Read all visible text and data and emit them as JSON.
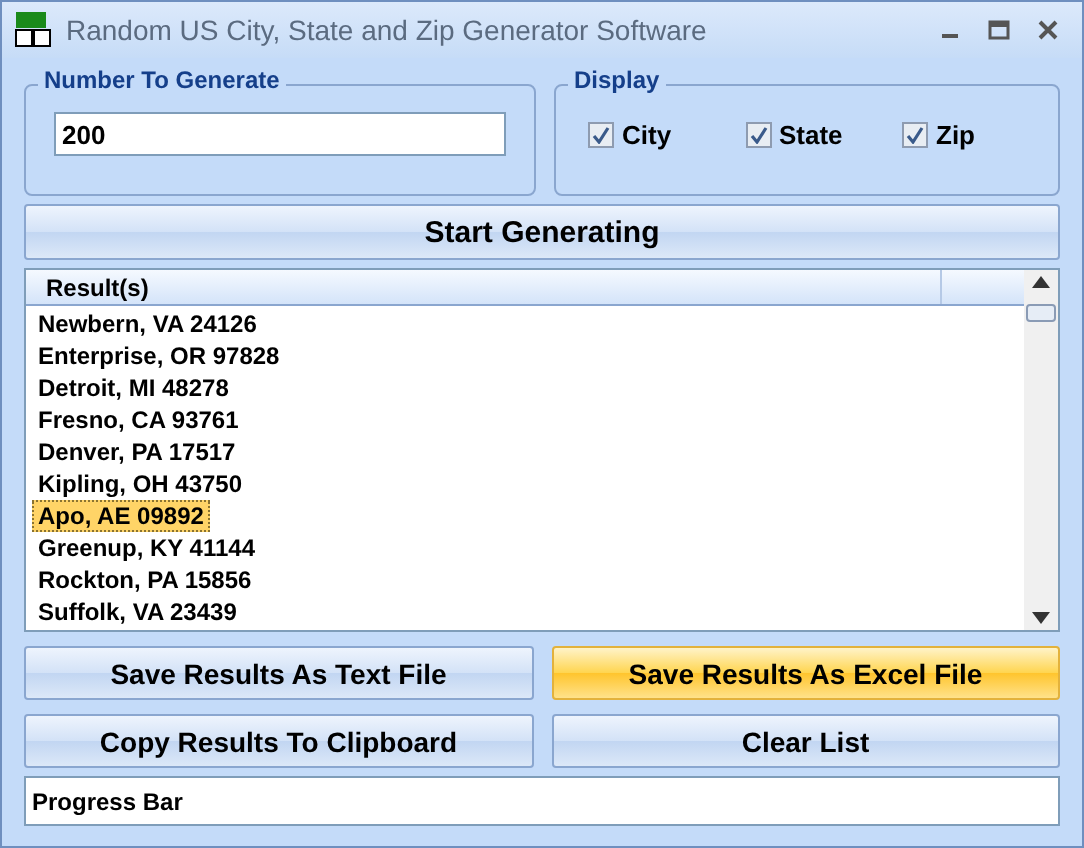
{
  "window": {
    "title": "Random US City, State and Zip Generator Software"
  },
  "number_group": {
    "label": "Number To Generate",
    "value": "200"
  },
  "display_group": {
    "label": "Display",
    "options": [
      {
        "label": "City",
        "checked": true
      },
      {
        "label": "State",
        "checked": true
      },
      {
        "label": "Zip",
        "checked": true
      }
    ]
  },
  "start_button": {
    "label": "Start Generating",
    "highlighted": false
  },
  "results": {
    "column": "Result(s)",
    "rows": [
      {
        "text": "Newbern, VA 24126",
        "selected": false
      },
      {
        "text": "Enterprise, OR 97828",
        "selected": false
      },
      {
        "text": "Detroit, MI 48278",
        "selected": false
      },
      {
        "text": "Fresno, CA 93761",
        "selected": false
      },
      {
        "text": "Denver, PA 17517",
        "selected": false
      },
      {
        "text": "Kipling, OH 43750",
        "selected": false
      },
      {
        "text": "Apo, AE 09892",
        "selected": true
      },
      {
        "text": "Greenup, KY 41144",
        "selected": false
      },
      {
        "text": "Rockton, PA 15856",
        "selected": false
      },
      {
        "text": "Suffolk, VA 23439",
        "selected": false
      }
    ]
  },
  "buttons": [
    {
      "label": "Save Results As Text File",
      "highlighted": false
    },
    {
      "label": "Save Results As Excel File",
      "highlighted": true
    },
    {
      "label": "Copy Results To Clipboard",
      "highlighted": false
    },
    {
      "label": "Clear List",
      "highlighted": false
    }
  ],
  "progress_bar": {
    "label": "Progress Bar",
    "level": 0
  }
}
